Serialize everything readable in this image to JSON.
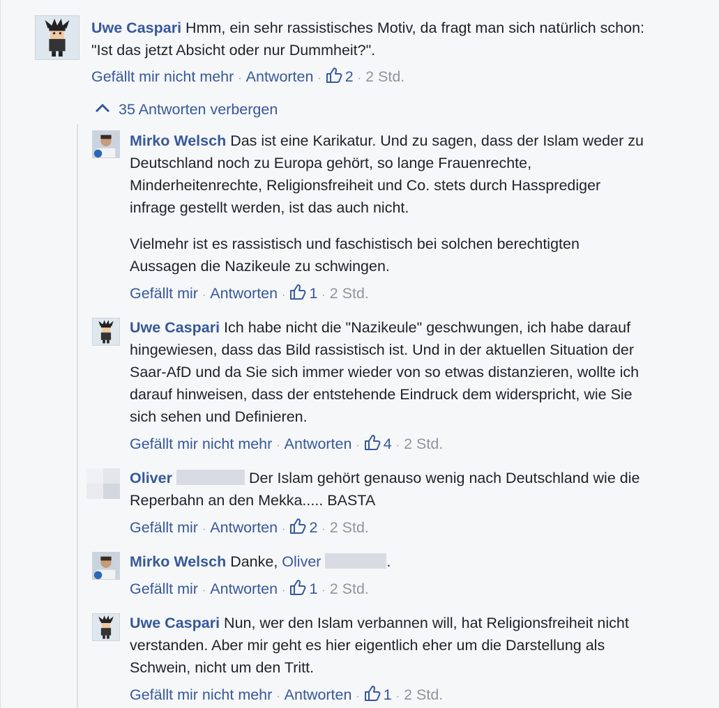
{
  "top_comment": {
    "author": "Uwe Caspari",
    "text": "Hmm, ein sehr rassistisches Motiv, da fragt man sich natürlich schon: \"Ist das jetzt Absicht oder nur Dummheit?\".",
    "actions": {
      "like": "Gefällt mir nicht mehr",
      "reply": "Antworten",
      "likes": "2",
      "time": "2 Std."
    }
  },
  "replies_toggle": {
    "label": "35 Antworten verbergen"
  },
  "replies": [
    {
      "author": "Mirko Welsch",
      "text1": "Das ist eine Karikatur. Und zu sagen, dass der Islam weder zu Deutschland noch zu Europa gehört, so lange Frauenrechte, Minderheitenrechte, Religionsfreiheit und Co. stets durch Hassprediger infrage gestellt werden, ist das auch nicht.",
      "text2": "Vielmehr ist es rassistisch und faschistisch bei solchen berechtigten Aussagen die Nazikeule zu schwingen.",
      "actions": {
        "like": "Gefällt mir",
        "reply": "Antworten",
        "likes": "1",
        "time": "2 Std."
      }
    },
    {
      "author": "Uwe Caspari",
      "text1": "Ich habe nicht die \"Nazikeule\" geschwungen, ich habe darauf hingewiesen, dass das Bild rassistisch ist. Und in der aktuellen Situation der Saar-AfD und da Sie sich immer wieder von so etwas distanzieren, wollte ich darauf hinweisen, dass der entstehende Eindruck dem widerspricht, wie Sie sich sehen und Definieren.",
      "actions": {
        "like": "Gefällt mir nicht mehr",
        "reply": "Antworten",
        "likes": "4",
        "time": "2 Std."
      }
    },
    {
      "author": "Oliver",
      "text1": "Der Islam gehört genauso wenig nach Deutschland wie die Reperbahn an den Mekka..... BASTA",
      "actions": {
        "like": "Gefällt mir",
        "reply": "Antworten",
        "likes": "2",
        "time": "2 Std."
      }
    },
    {
      "author": "Mirko Welsch",
      "text1": "Danke,",
      "mention": "Oliver",
      "text_end": ".",
      "actions": {
        "like": "Gefällt mir",
        "reply": "Antworten",
        "likes": "1",
        "time": "2 Std."
      }
    },
    {
      "author": "Uwe Caspari",
      "text1": "Nun, wer den Islam verbannen will, hat Religionsfreiheit nicht verstanden. Aber mir geht es hier eigentlich eher um die Darstellung als Schwein, nicht um den Tritt.",
      "actions": {
        "like": "Gefällt mir nicht mehr",
        "reply": "Antworten",
        "likes": "1",
        "time": "2 Std."
      }
    }
  ],
  "colors": {
    "link": "#365899",
    "meta": "#90949c",
    "text": "#1d2129",
    "background": "#f6f7f9"
  }
}
